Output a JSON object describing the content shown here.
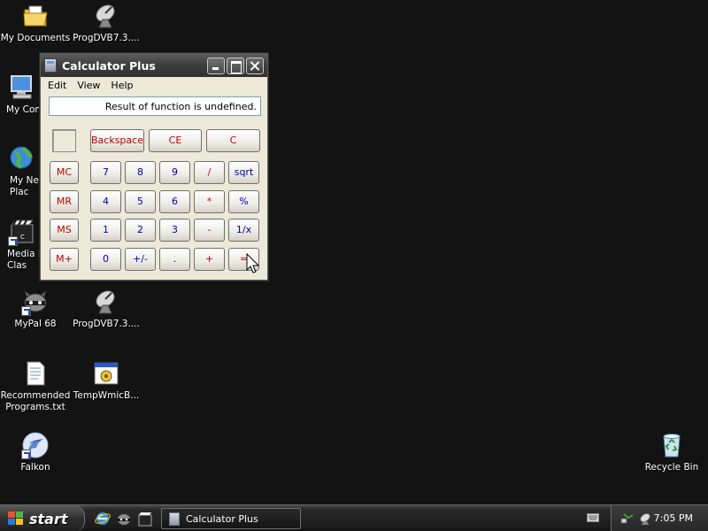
{
  "desktop": {
    "icons": [
      {
        "label": "My Documents",
        "icon": "folder-documents-icon"
      },
      {
        "label": "ProgDVB7.3....",
        "icon": "satellite-dish-icon"
      },
      {
        "label": "My Com",
        "icon": "computer-icon"
      },
      {
        "label": "My Net\nPlac",
        "icon": "network-globe-icon"
      },
      {
        "label": "Media P\nClas",
        "icon": "media-player-icon"
      },
      {
        "label": "MyPal 68",
        "icon": "raccoon-icon"
      },
      {
        "label": "ProgDVB7.3....",
        "icon": "satellite-dish-icon"
      },
      {
        "label": "Recommended\nPrograms.txt",
        "icon": "text-file-icon"
      },
      {
        "label": "TempWmicB...",
        "icon": "batch-file-icon"
      },
      {
        "label": "Falkon",
        "icon": "falkon-browser-icon"
      },
      {
        "label": "Recycle Bin",
        "icon": "recycle-bin-icon"
      }
    ]
  },
  "window": {
    "title": "Calculator Plus",
    "menu": [
      "Edit",
      "View",
      "Help"
    ],
    "display_value": "Result of function is undefined.",
    "buttons": {
      "backspace": "Backspace",
      "ce": "CE",
      "c": "C",
      "mc": "MC",
      "mr": "MR",
      "ms": "MS",
      "mplus": "M+",
      "d7": "7",
      "d8": "8",
      "d9": "9",
      "d4": "4",
      "d5": "5",
      "d6": "6",
      "d1": "1",
      "d2": "2",
      "d3": "3",
      "d0": "0",
      "sign": "+/-",
      "dot": ".",
      "div": "/",
      "mul": "*",
      "sub": "-",
      "add": "+",
      "sqrt": "sqrt",
      "pct": "%",
      "recip": "1/x",
      "eq": "="
    }
  },
  "taskbar": {
    "start_label": "start",
    "task_item": "Calculator Plus",
    "clock": "7:05 PM"
  }
}
